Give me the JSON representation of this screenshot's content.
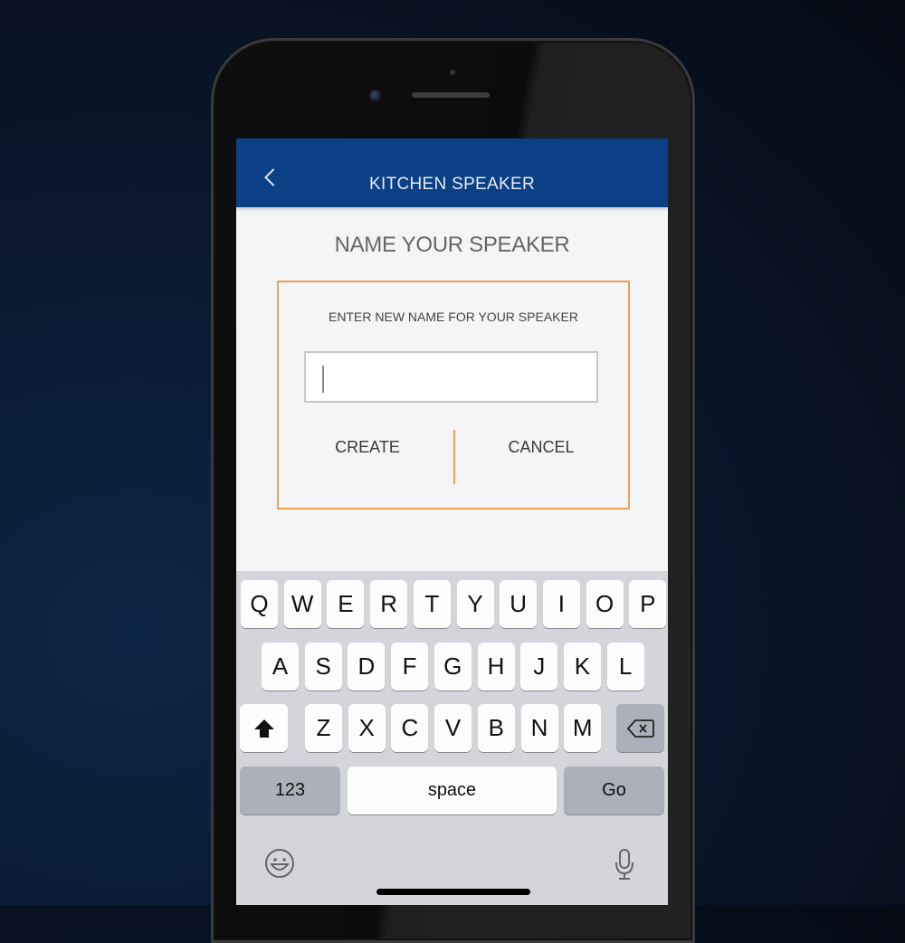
{
  "navbar": {
    "title": "KITCHEN SPEAKER",
    "back_icon": "chevron-left-icon",
    "color": "#0b3f86"
  },
  "page": {
    "heading": "NAME YOUR SPEAKER"
  },
  "dialog": {
    "label": "ENTER NEW NAME FOR YOUR SPEAKER",
    "input_value": "",
    "create_label": "CREATE",
    "cancel_label": "CANCEL",
    "accent": "#f0a055"
  },
  "keyboard": {
    "row1": [
      "Q",
      "W",
      "E",
      "R",
      "T",
      "Y",
      "U",
      "I",
      "O",
      "P"
    ],
    "row2": [
      "A",
      "S",
      "D",
      "F",
      "G",
      "H",
      "J",
      "K",
      "L"
    ],
    "row3": [
      "Z",
      "X",
      "C",
      "V",
      "B",
      "N",
      "M"
    ],
    "numbers_label": "123",
    "space_label": "space",
    "go_label": "Go",
    "shift_icon": "shift-icon",
    "backspace_icon": "backspace-icon",
    "emoji_icon": "emoji-icon",
    "mic_icon": "microphone-icon"
  }
}
